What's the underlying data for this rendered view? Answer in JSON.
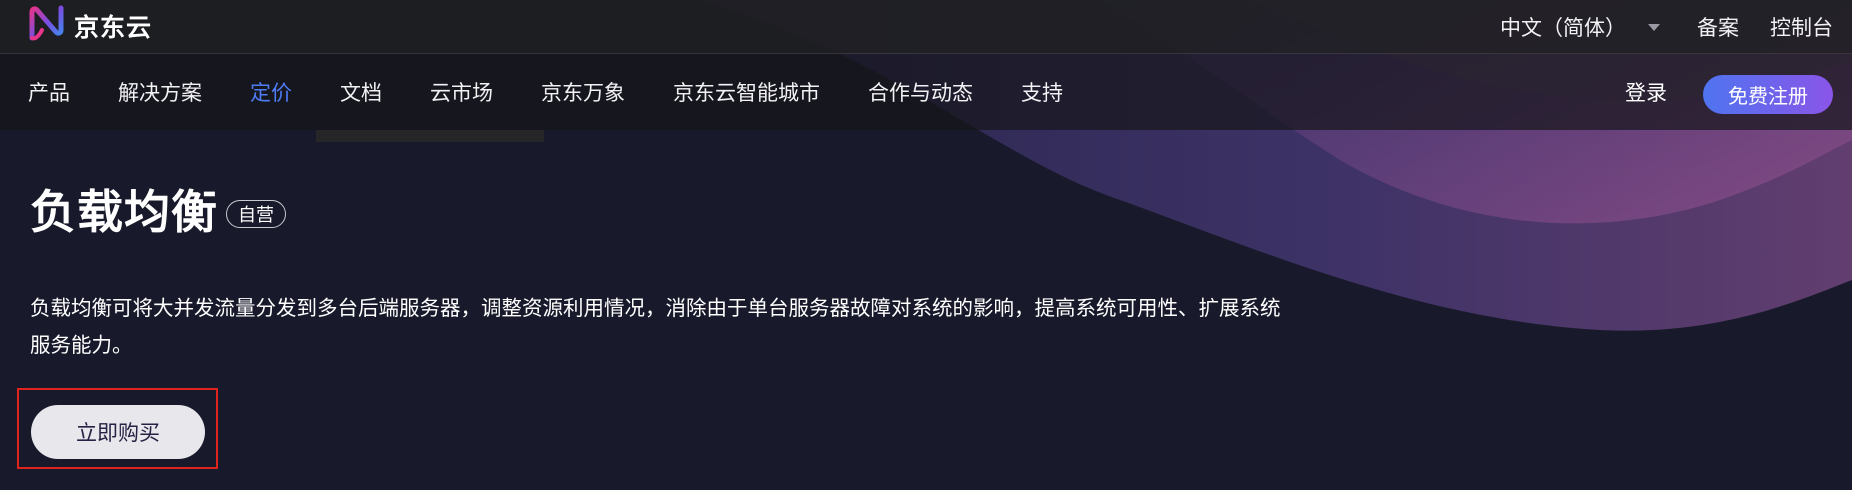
{
  "brand": {
    "name": "京东云",
    "logo_icon": "jd-cloud-logo-icon"
  },
  "topbar": {
    "language": "中文（简体）",
    "language_caret_icon": "caret-down-icon",
    "beian": "备案",
    "console": "控制台"
  },
  "nav": {
    "items": [
      {
        "label": "产品",
        "active": false
      },
      {
        "label": "解决方案",
        "active": false
      },
      {
        "label": "定价",
        "active": true
      },
      {
        "label": "文档",
        "active": false
      },
      {
        "label": "云市场",
        "active": false
      },
      {
        "label": "京东万象",
        "active": false
      },
      {
        "label": "京东云智能城市",
        "active": false
      },
      {
        "label": "合作与动态",
        "active": false
      },
      {
        "label": "支持",
        "active": false
      }
    ],
    "login": "登录",
    "register": "免费注册"
  },
  "hero": {
    "title": "负载均衡",
    "badge": "自营",
    "description": "负载均衡可将大并发流量分发到多台后端服务器，调整资源利用情况，消除由于单台服务器故障对系统的影响，提高系统可用性、扩展系统服务能力。",
    "buy_button": "立即购买"
  },
  "colors": {
    "accent": "#4f7df7",
    "register_gradient_start": "#4f74f0",
    "register_gradient_end": "#8a55e8",
    "highlight_outline": "#e0231d",
    "background": "#181a2b"
  }
}
